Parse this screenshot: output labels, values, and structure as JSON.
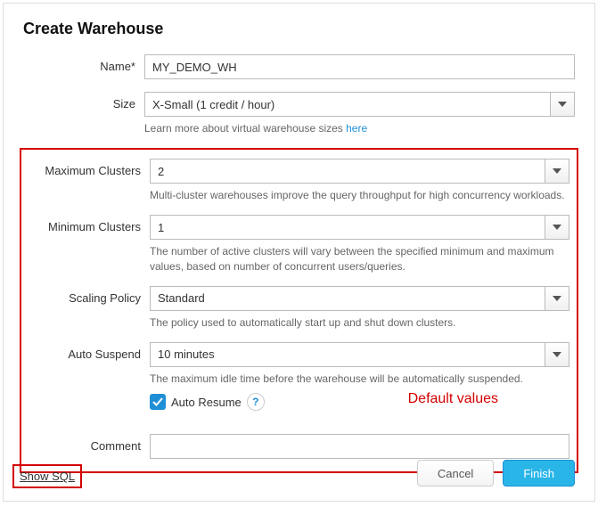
{
  "title": "Create Warehouse",
  "fields": {
    "name": {
      "label": "Name*",
      "value": "MY_DEMO_WH"
    },
    "size": {
      "label": "Size",
      "value": "X-Small  (1 credit / hour)",
      "help_prefix": "Learn more about virtual warehouse sizes ",
      "help_link": "here"
    },
    "max_clusters": {
      "label": "Maximum Clusters",
      "value": "2",
      "help": "Multi-cluster warehouses improve the query throughput for high concurrency workloads."
    },
    "min_clusters": {
      "label": "Minimum Clusters",
      "value": "1",
      "help": "The number of active clusters will vary between the specified minimum and maximum values, based on number of concurrent users/queries."
    },
    "scaling_policy": {
      "label": "Scaling Policy",
      "value": "Standard",
      "help": "The policy used to automatically start up and shut down clusters."
    },
    "auto_suspend": {
      "label": "Auto Suspend",
      "value": "10 minutes",
      "help": "The maximum idle time before the warehouse will be automatically suspended."
    },
    "auto_resume": {
      "label": "Auto Resume"
    },
    "comment": {
      "label": "Comment",
      "value": ""
    }
  },
  "annotations": {
    "default_values": "Default values"
  },
  "footer": {
    "show_sql": "Show SQL",
    "cancel": "Cancel",
    "finish": "Finish"
  }
}
